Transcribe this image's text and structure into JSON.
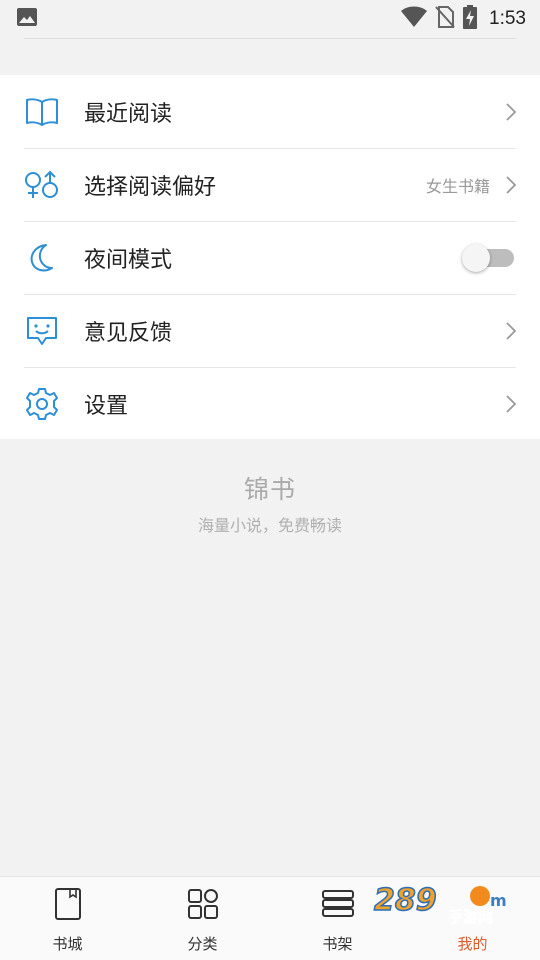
{
  "status_bar": {
    "time": "1:53",
    "icons": [
      "image-notification-icon",
      "wifi-icon",
      "no-sim-icon",
      "battery-charging-icon"
    ]
  },
  "menu": {
    "items": [
      {
        "id": "recent",
        "label": "最近阅读",
        "icon": "book-open-icon",
        "trailing": "chevron"
      },
      {
        "id": "preference",
        "label": "选择阅读偏好",
        "icon": "gender-icon",
        "value": "女生书籍",
        "trailing": "chevron"
      },
      {
        "id": "night",
        "label": "夜间模式",
        "icon": "moon-icon",
        "trailing": "toggle",
        "toggle_on": false
      },
      {
        "id": "feedback",
        "label": "意见反馈",
        "icon": "smile-message-icon",
        "trailing": "chevron"
      },
      {
        "id": "settings",
        "label": "设置",
        "icon": "gear-icon",
        "trailing": "chevron"
      }
    ]
  },
  "brand": {
    "name": "锦书",
    "slogan": "海量小说，免费畅读"
  },
  "bottom_nav": {
    "items": [
      {
        "label": "书城",
        "icon": "bookstore-icon",
        "active": false
      },
      {
        "label": "分类",
        "icon": "category-grid-icon",
        "active": false
      },
      {
        "label": "书架",
        "icon": "bookshelf-icon",
        "active": false
      },
      {
        "label": "我的",
        "icon": "profile-icon",
        "active": true
      }
    ]
  },
  "colors": {
    "accent_icon": "#2d8fd5",
    "active_tab": "#e05a2b",
    "background": "#f2f2f2"
  },
  "watermark": "289手游网"
}
